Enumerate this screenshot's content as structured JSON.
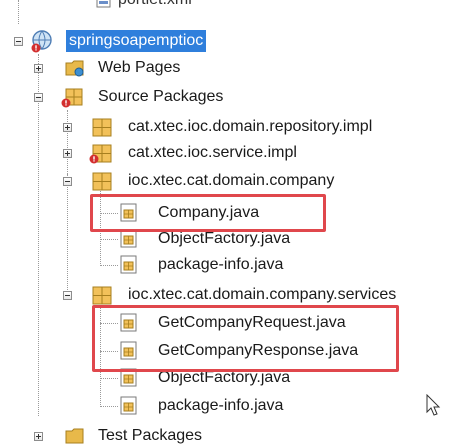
{
  "tree": {
    "top_partial_label": "portlet.xml",
    "project": {
      "label": "springsoapemptioc"
    },
    "web_pages": {
      "label": "Web Pages"
    },
    "source_packages": {
      "label": "Source Packages"
    },
    "packages": [
      {
        "label": "cat.xtec.ioc.domain.repository.impl"
      },
      {
        "label": "cat.xtec.ioc.service.impl"
      },
      {
        "label": "ioc.xtec.cat.domain.company",
        "files": [
          "Company.java",
          "ObjectFactory.java",
          "package-info.java"
        ]
      },
      {
        "label": "ioc.xtec.cat.domain.company.services",
        "files": [
          "GetCompanyRequest.java",
          "GetCompanyResponse.java",
          "ObjectFactory.java",
          "package-info.java"
        ]
      }
    ],
    "test_packages": {
      "label": "Test Packages"
    }
  },
  "colors": {
    "selection": "#2f7fdc",
    "highlight_box": "#e0474c",
    "package_fill": "#f2c15a",
    "error_badge": "#d32f2f"
  },
  "icons": {
    "project": "globe-project-icon",
    "folder": "folder-icon",
    "package": "package-icon",
    "java_file": "java-file-icon",
    "error": "error-badge-icon",
    "cursor": "mouse-cursor-icon"
  }
}
